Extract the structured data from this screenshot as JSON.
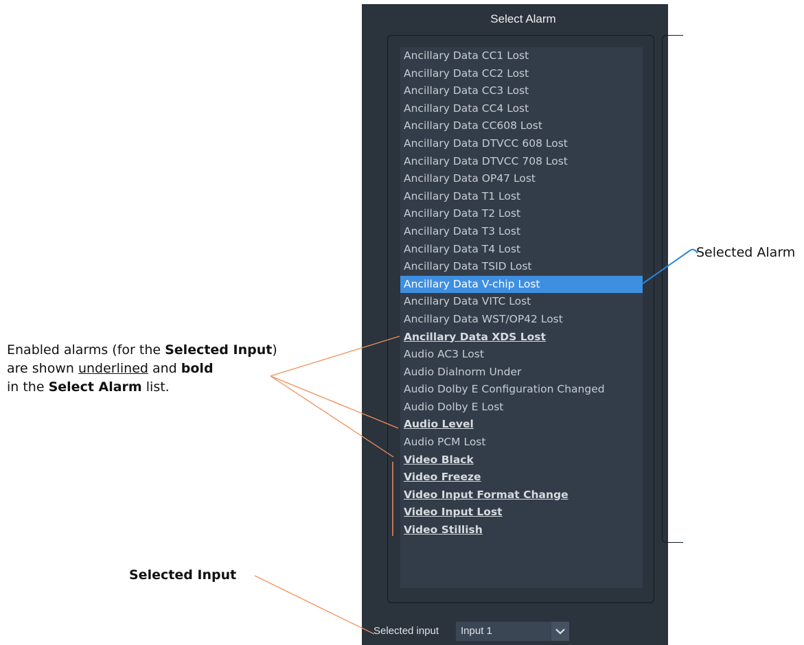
{
  "panel": {
    "title": "Select Alarm",
    "alarms": [
      {
        "label": "Ancillary Data CC1 Lost",
        "enabled": false,
        "selected": false
      },
      {
        "label": "Ancillary Data CC2 Lost",
        "enabled": false,
        "selected": false
      },
      {
        "label": "Ancillary Data CC3 Lost",
        "enabled": false,
        "selected": false
      },
      {
        "label": "Ancillary Data CC4 Lost",
        "enabled": false,
        "selected": false
      },
      {
        "label": "Ancillary Data CC608 Lost",
        "enabled": false,
        "selected": false
      },
      {
        "label": "Ancillary Data DTVCC 608 Lost",
        "enabled": false,
        "selected": false
      },
      {
        "label": "Ancillary Data DTVCC 708 Lost",
        "enabled": false,
        "selected": false
      },
      {
        "label": "Ancillary Data OP47 Lost",
        "enabled": false,
        "selected": false
      },
      {
        "label": "Ancillary Data T1 Lost",
        "enabled": false,
        "selected": false
      },
      {
        "label": "Ancillary Data T2 Lost",
        "enabled": false,
        "selected": false
      },
      {
        "label": "Ancillary Data T3 Lost",
        "enabled": false,
        "selected": false
      },
      {
        "label": "Ancillary Data T4 Lost",
        "enabled": false,
        "selected": false
      },
      {
        "label": "Ancillary Data TSID Lost",
        "enabled": false,
        "selected": false
      },
      {
        "label": "Ancillary Data V-chip Lost",
        "enabled": false,
        "selected": true
      },
      {
        "label": "Ancillary Data VITC Lost",
        "enabled": false,
        "selected": false
      },
      {
        "label": "Ancillary Data WST/OP42 Lost",
        "enabled": false,
        "selected": false
      },
      {
        "label": "Ancillary Data XDS Lost",
        "enabled": true,
        "selected": false
      },
      {
        "label": "Audio AC3 Lost",
        "enabled": false,
        "selected": false
      },
      {
        "label": "Audio Dialnorm Under",
        "enabled": false,
        "selected": false
      },
      {
        "label": "Audio Dolby E Configuration Changed",
        "enabled": false,
        "selected": false
      },
      {
        "label": "Audio Dolby E Lost",
        "enabled": false,
        "selected": false
      },
      {
        "label": "Audio Level",
        "enabled": true,
        "selected": false
      },
      {
        "label": "Audio PCM Lost",
        "enabled": false,
        "selected": false
      },
      {
        "label": "Video Black",
        "enabled": true,
        "selected": false
      },
      {
        "label": "Video Freeze",
        "enabled": true,
        "selected": false
      },
      {
        "label": "Video Input Format Change",
        "enabled": true,
        "selected": false
      },
      {
        "label": "Video Input Lost",
        "enabled": true,
        "selected": false
      },
      {
        "label": "Video Stillish",
        "enabled": true,
        "selected": false
      }
    ],
    "input_label": "Selected input",
    "input_value": "Input 1"
  },
  "annotations": {
    "selected_alarm": "Selected Alarm",
    "enabled_line1_a": "Enabled alarms (for the ",
    "enabled_line1_b": "Selected Input",
    "enabled_line1_c": ")",
    "enabled_line2_a": "are shown ",
    "enabled_line2_b": "underlined",
    "enabled_line2_c": " and ",
    "enabled_line2_d": "bold",
    "enabled_line3_a": "in the ",
    "enabled_line3_b": "Select Alarm",
    "enabled_line3_c": " list.",
    "selected_input": "Selected Input"
  },
  "colors": {
    "panel_bg": "#2b333d",
    "list_bg": "#333d49",
    "selection": "#3e8fe0",
    "callout_orange": "#f0905a",
    "callout_blue": "#2a86d8"
  }
}
